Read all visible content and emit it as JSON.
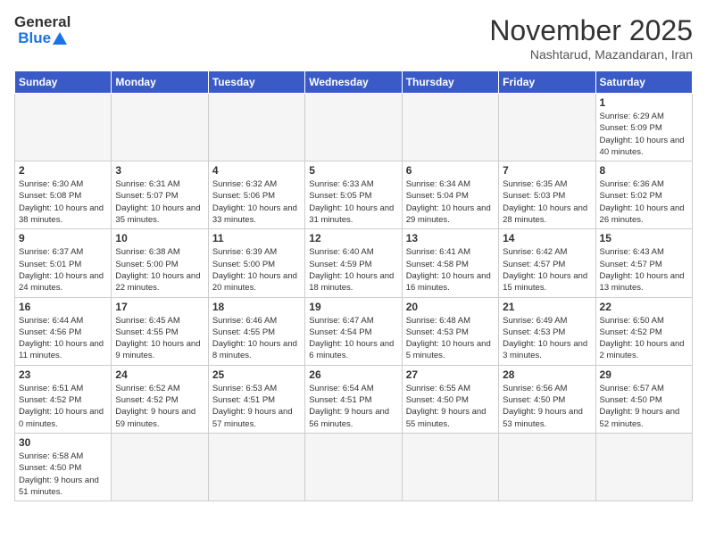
{
  "logo": {
    "text_general": "General",
    "text_blue": "Blue"
  },
  "header": {
    "month": "November 2025",
    "location": "Nashtarud, Mazandaran, Iran"
  },
  "weekdays": [
    "Sunday",
    "Monday",
    "Tuesday",
    "Wednesday",
    "Thursday",
    "Friday",
    "Saturday"
  ],
  "weeks": [
    [
      {
        "day": "",
        "info": ""
      },
      {
        "day": "",
        "info": ""
      },
      {
        "day": "",
        "info": ""
      },
      {
        "day": "",
        "info": ""
      },
      {
        "day": "",
        "info": ""
      },
      {
        "day": "",
        "info": ""
      },
      {
        "day": "1",
        "info": "Sunrise: 6:29 AM\nSunset: 5:09 PM\nDaylight: 10 hours and 40 minutes."
      }
    ],
    [
      {
        "day": "2",
        "info": "Sunrise: 6:30 AM\nSunset: 5:08 PM\nDaylight: 10 hours and 38 minutes."
      },
      {
        "day": "3",
        "info": "Sunrise: 6:31 AM\nSunset: 5:07 PM\nDaylight: 10 hours and 35 minutes."
      },
      {
        "day": "4",
        "info": "Sunrise: 6:32 AM\nSunset: 5:06 PM\nDaylight: 10 hours and 33 minutes."
      },
      {
        "day": "5",
        "info": "Sunrise: 6:33 AM\nSunset: 5:05 PM\nDaylight: 10 hours and 31 minutes."
      },
      {
        "day": "6",
        "info": "Sunrise: 6:34 AM\nSunset: 5:04 PM\nDaylight: 10 hours and 29 minutes."
      },
      {
        "day": "7",
        "info": "Sunrise: 6:35 AM\nSunset: 5:03 PM\nDaylight: 10 hours and 28 minutes."
      },
      {
        "day": "8",
        "info": "Sunrise: 6:36 AM\nSunset: 5:02 PM\nDaylight: 10 hours and 26 minutes."
      }
    ],
    [
      {
        "day": "9",
        "info": "Sunrise: 6:37 AM\nSunset: 5:01 PM\nDaylight: 10 hours and 24 minutes."
      },
      {
        "day": "10",
        "info": "Sunrise: 6:38 AM\nSunset: 5:00 PM\nDaylight: 10 hours and 22 minutes."
      },
      {
        "day": "11",
        "info": "Sunrise: 6:39 AM\nSunset: 5:00 PM\nDaylight: 10 hours and 20 minutes."
      },
      {
        "day": "12",
        "info": "Sunrise: 6:40 AM\nSunset: 4:59 PM\nDaylight: 10 hours and 18 minutes."
      },
      {
        "day": "13",
        "info": "Sunrise: 6:41 AM\nSunset: 4:58 PM\nDaylight: 10 hours and 16 minutes."
      },
      {
        "day": "14",
        "info": "Sunrise: 6:42 AM\nSunset: 4:57 PM\nDaylight: 10 hours and 15 minutes."
      },
      {
        "day": "15",
        "info": "Sunrise: 6:43 AM\nSunset: 4:57 PM\nDaylight: 10 hours and 13 minutes."
      }
    ],
    [
      {
        "day": "16",
        "info": "Sunrise: 6:44 AM\nSunset: 4:56 PM\nDaylight: 10 hours and 11 minutes."
      },
      {
        "day": "17",
        "info": "Sunrise: 6:45 AM\nSunset: 4:55 PM\nDaylight: 10 hours and 9 minutes."
      },
      {
        "day": "18",
        "info": "Sunrise: 6:46 AM\nSunset: 4:55 PM\nDaylight: 10 hours and 8 minutes."
      },
      {
        "day": "19",
        "info": "Sunrise: 6:47 AM\nSunset: 4:54 PM\nDaylight: 10 hours and 6 minutes."
      },
      {
        "day": "20",
        "info": "Sunrise: 6:48 AM\nSunset: 4:53 PM\nDaylight: 10 hours and 5 minutes."
      },
      {
        "day": "21",
        "info": "Sunrise: 6:49 AM\nSunset: 4:53 PM\nDaylight: 10 hours and 3 minutes."
      },
      {
        "day": "22",
        "info": "Sunrise: 6:50 AM\nSunset: 4:52 PM\nDaylight: 10 hours and 2 minutes."
      }
    ],
    [
      {
        "day": "23",
        "info": "Sunrise: 6:51 AM\nSunset: 4:52 PM\nDaylight: 10 hours and 0 minutes."
      },
      {
        "day": "24",
        "info": "Sunrise: 6:52 AM\nSunset: 4:52 PM\nDaylight: 9 hours and 59 minutes."
      },
      {
        "day": "25",
        "info": "Sunrise: 6:53 AM\nSunset: 4:51 PM\nDaylight: 9 hours and 57 minutes."
      },
      {
        "day": "26",
        "info": "Sunrise: 6:54 AM\nSunset: 4:51 PM\nDaylight: 9 hours and 56 minutes."
      },
      {
        "day": "27",
        "info": "Sunrise: 6:55 AM\nSunset: 4:50 PM\nDaylight: 9 hours and 55 minutes."
      },
      {
        "day": "28",
        "info": "Sunrise: 6:56 AM\nSunset: 4:50 PM\nDaylight: 9 hours and 53 minutes."
      },
      {
        "day": "29",
        "info": "Sunrise: 6:57 AM\nSunset: 4:50 PM\nDaylight: 9 hours and 52 minutes."
      }
    ],
    [
      {
        "day": "30",
        "info": "Sunrise: 6:58 AM\nSunset: 4:50 PM\nDaylight: 9 hours and 51 minutes."
      },
      {
        "day": "",
        "info": ""
      },
      {
        "day": "",
        "info": ""
      },
      {
        "day": "",
        "info": ""
      },
      {
        "day": "",
        "info": ""
      },
      {
        "day": "",
        "info": ""
      },
      {
        "day": "",
        "info": ""
      }
    ]
  ]
}
